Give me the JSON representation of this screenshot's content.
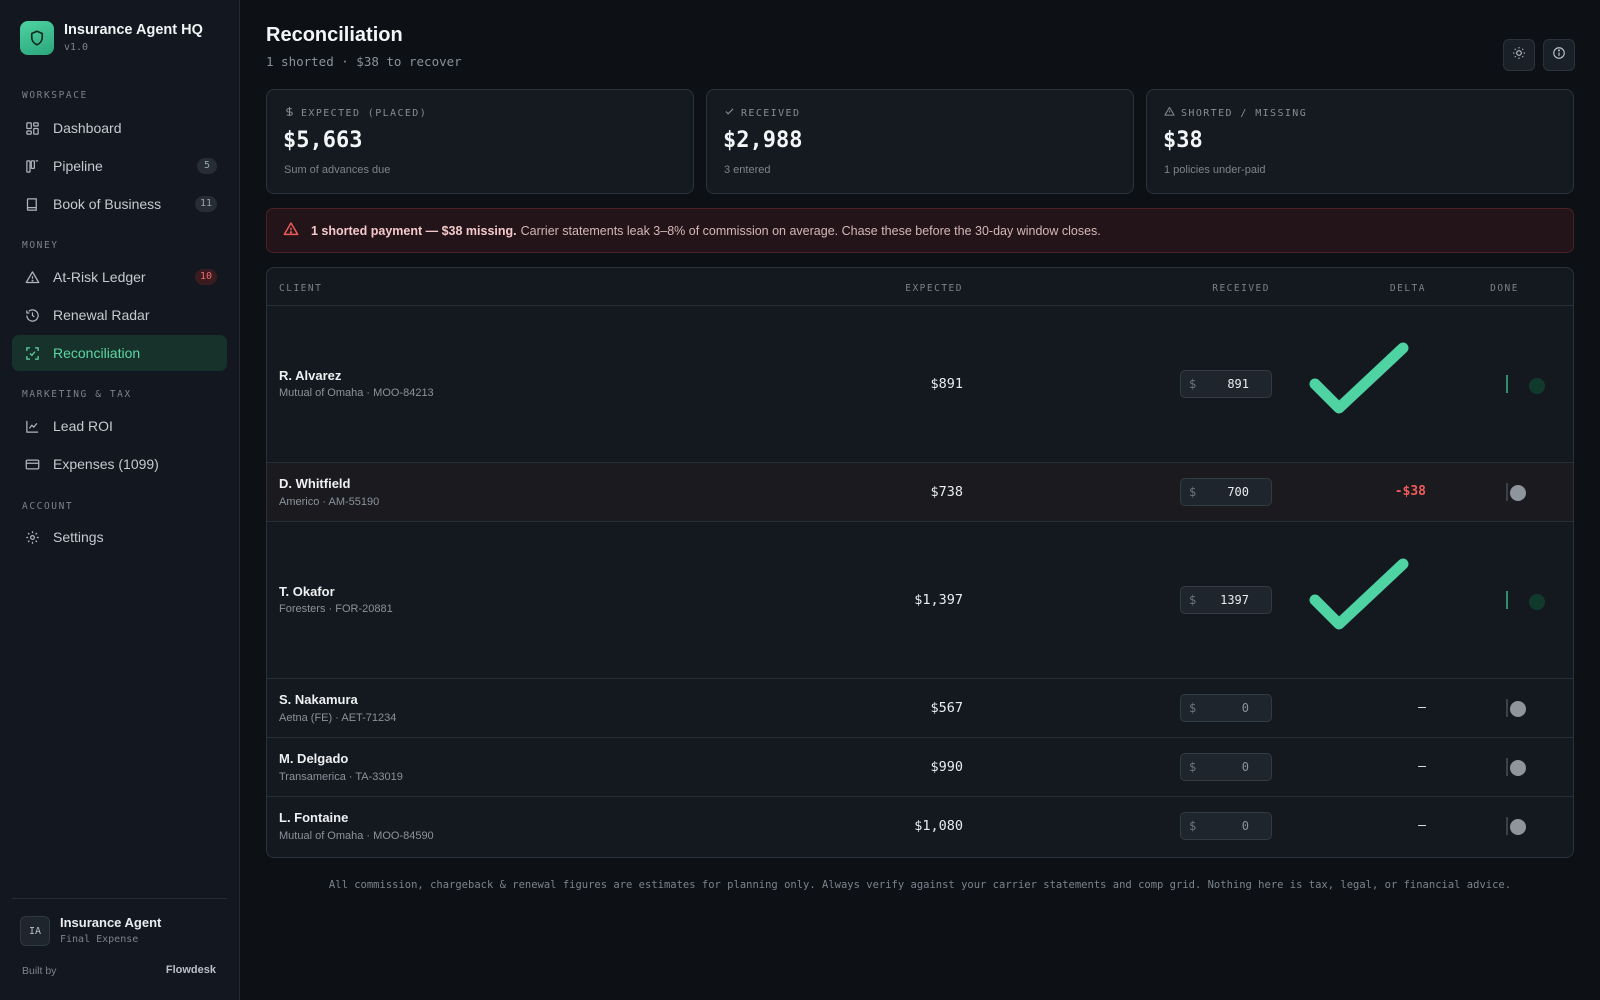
{
  "app": {
    "name": "Insurance Agent HQ",
    "version": "v1.0"
  },
  "sidebar": {
    "sections": [
      {
        "label": "WORKSPACE",
        "items": [
          {
            "label": "Dashboard",
            "icon": "dashboard-icon",
            "badge": ""
          },
          {
            "label": "Pipeline",
            "icon": "pipeline-icon",
            "badge": "5"
          },
          {
            "label": "Book of Business",
            "icon": "book-icon",
            "badge": "11"
          }
        ]
      },
      {
        "label": "MONEY",
        "items": [
          {
            "label": "At-Risk Ledger",
            "icon": "warning-icon",
            "badge": "10"
          },
          {
            "label": "Renewal Radar",
            "icon": "history-icon",
            "badge": ""
          },
          {
            "label": "Reconciliation",
            "icon": "reconcile-icon",
            "badge": ""
          }
        ]
      },
      {
        "label": "MARKETING & TAX",
        "items": [
          {
            "label": "Lead ROI",
            "icon": "line-chart-icon",
            "badge": ""
          },
          {
            "label": "Expenses (1099)",
            "icon": "card-icon",
            "badge": ""
          }
        ]
      },
      {
        "label": "ACCOUNT",
        "items": [
          {
            "label": "Settings",
            "icon": "gear-icon",
            "badge": ""
          }
        ]
      }
    ],
    "active": "Reconciliation",
    "profile": {
      "initials": "IA",
      "name": "Insurance Agent",
      "role": "Final Expense"
    },
    "built_by_label": "Built by",
    "built_by_brand": "Flowdesk"
  },
  "header": {
    "title": "Reconciliation",
    "subtitle": "1 shorted · $38 to recover"
  },
  "stats": [
    {
      "label": "EXPECTED (PLACED)",
      "icon": "dollar-icon",
      "value": "$5,663",
      "note": "Sum of advances due"
    },
    {
      "label": "RECEIVED",
      "icon": "check-icon",
      "value": "$2,988",
      "note": "3 entered"
    },
    {
      "label": "SHORTED / MISSING",
      "icon": "warning-icon",
      "value": "$38",
      "note": "1 policies under-paid"
    }
  ],
  "alert": {
    "strong": "1 shorted payment — $38 missing.",
    "text": "Carrier statements leak 3–8% of commission on average. Chase these before the 30-day window closes."
  },
  "table": {
    "columns": {
      "client": "CLIENT",
      "expected": "EXPECTED",
      "received": "RECEIVED",
      "delta": "DELTA",
      "done": "DONE"
    },
    "currency_symbol": "$",
    "rows": [
      {
        "name": "R. Alvarez",
        "meta": "Mutual of Omaha · MOO-84213",
        "expected": "$891",
        "received": "891",
        "delta": "",
        "status": "paid",
        "done": true
      },
      {
        "name": "D. Whitfield",
        "meta": "Americo · AM-55190",
        "expected": "$738",
        "received": "700",
        "delta": "-$38",
        "status": "shorted",
        "done": false
      },
      {
        "name": "T. Okafor",
        "meta": "Foresters · FOR-20881",
        "expected": "$1,397",
        "received": "1397",
        "delta": "",
        "status": "paid",
        "done": true
      },
      {
        "name": "S. Nakamura",
        "meta": "Aetna (FE) · AET-71234",
        "expected": "$567",
        "received": "0",
        "delta": "–",
        "status": "pending",
        "done": false
      },
      {
        "name": "M. Delgado",
        "meta": "Transamerica · TA-33019",
        "expected": "$990",
        "received": "0",
        "delta": "–",
        "status": "pending",
        "done": false
      },
      {
        "name": "L. Fontaine",
        "meta": "Mutual of Omaha · MOO-84590",
        "expected": "$1,080",
        "received": "0",
        "delta": "–",
        "status": "pending",
        "done": false
      }
    ]
  },
  "disclaimer": "All commission, chargeback & renewal figures are estimates for planning only. Always verify against your carrier statements and comp grid. Nothing here is tax, legal, or financial advice.",
  "colors": {
    "accent": "#4fd3a3",
    "danger": "#ef5b5b",
    "background": "#0d1014",
    "panel": "#151a20"
  }
}
